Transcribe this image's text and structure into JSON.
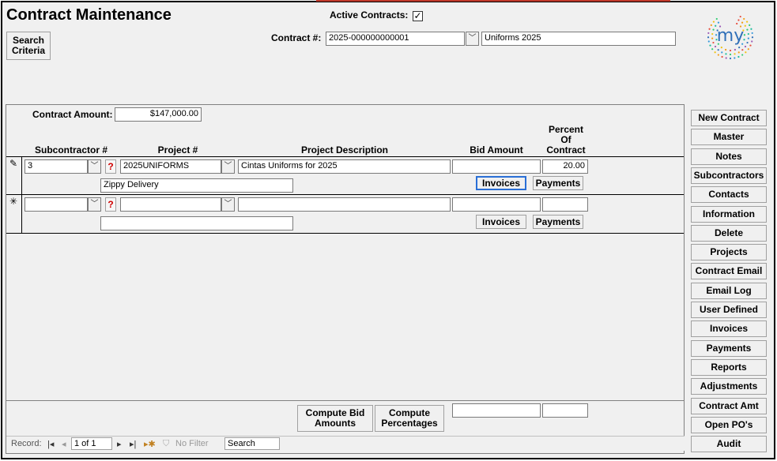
{
  "title": "Contract Maintenance",
  "search_criteria_label": "Search Criteria",
  "active_contracts": {
    "label": "Active Contracts:",
    "checked": true,
    "mark": "✓"
  },
  "contract_number": {
    "label": "Contract #:",
    "value": "2025-000000000001",
    "description": "Uniforms 2025"
  },
  "contract_amount": {
    "label": "Contract Amount:",
    "value": "$147,000.00"
  },
  "columns": {
    "subcontractor": "Subcontractor #",
    "project": "Project #",
    "project_description": "Project Description",
    "bid_amount": "Bid Amount",
    "percent_of_contract": "Percent Of Contract"
  },
  "rows": [
    {
      "selector_glyph": "✎",
      "subcontractor": "3",
      "project": "2025UNIFORMS",
      "project_description": "Cintas Uniforms for 2025",
      "bid_amount": "",
      "percent": "20.00",
      "subcontractor_name": "Zippy Delivery",
      "invoices_label": "Invoices",
      "payments_label": "Payments"
    },
    {
      "selector_glyph": "✳",
      "subcontractor": "",
      "project": "",
      "project_description": "",
      "bid_amount": "",
      "percent": "",
      "subcontractor_name": "",
      "invoices_label": "Invoices",
      "payments_label": "Payments"
    }
  ],
  "compute_bid_amounts_label": "Compute Bid Amounts",
  "compute_percentages_label": "Compute Percentages",
  "qmark": "?",
  "right_buttons": [
    "New Contract",
    "Master",
    "Notes",
    "Subcontractors",
    "Contacts",
    "Information",
    "Delete",
    "Projects",
    "Contract Email",
    "Email Log",
    "User Defined",
    "Invoices",
    "Payments",
    "Reports",
    "Adjustments",
    "Contract Amt",
    "Open PO's",
    "Audit"
  ],
  "navigation": {
    "record_label": "Record:",
    "first_glyph": "|◂",
    "prev_glyph": "◂",
    "record_value": "1 of 1",
    "next_glyph": "▸",
    "last_glyph": "▸|",
    "new_glyph": "▸✱",
    "no_filter_label": "No Filter",
    "search_label": "Search"
  },
  "colors": {
    "accent_red": "#c0392b",
    "active_blue": "#2a6fd6",
    "qmark_red": "#d00000"
  },
  "icons": {
    "dropdown": "chevron-down-icon",
    "edit_record": "pencil-icon",
    "new_record": "asterisk-icon"
  }
}
